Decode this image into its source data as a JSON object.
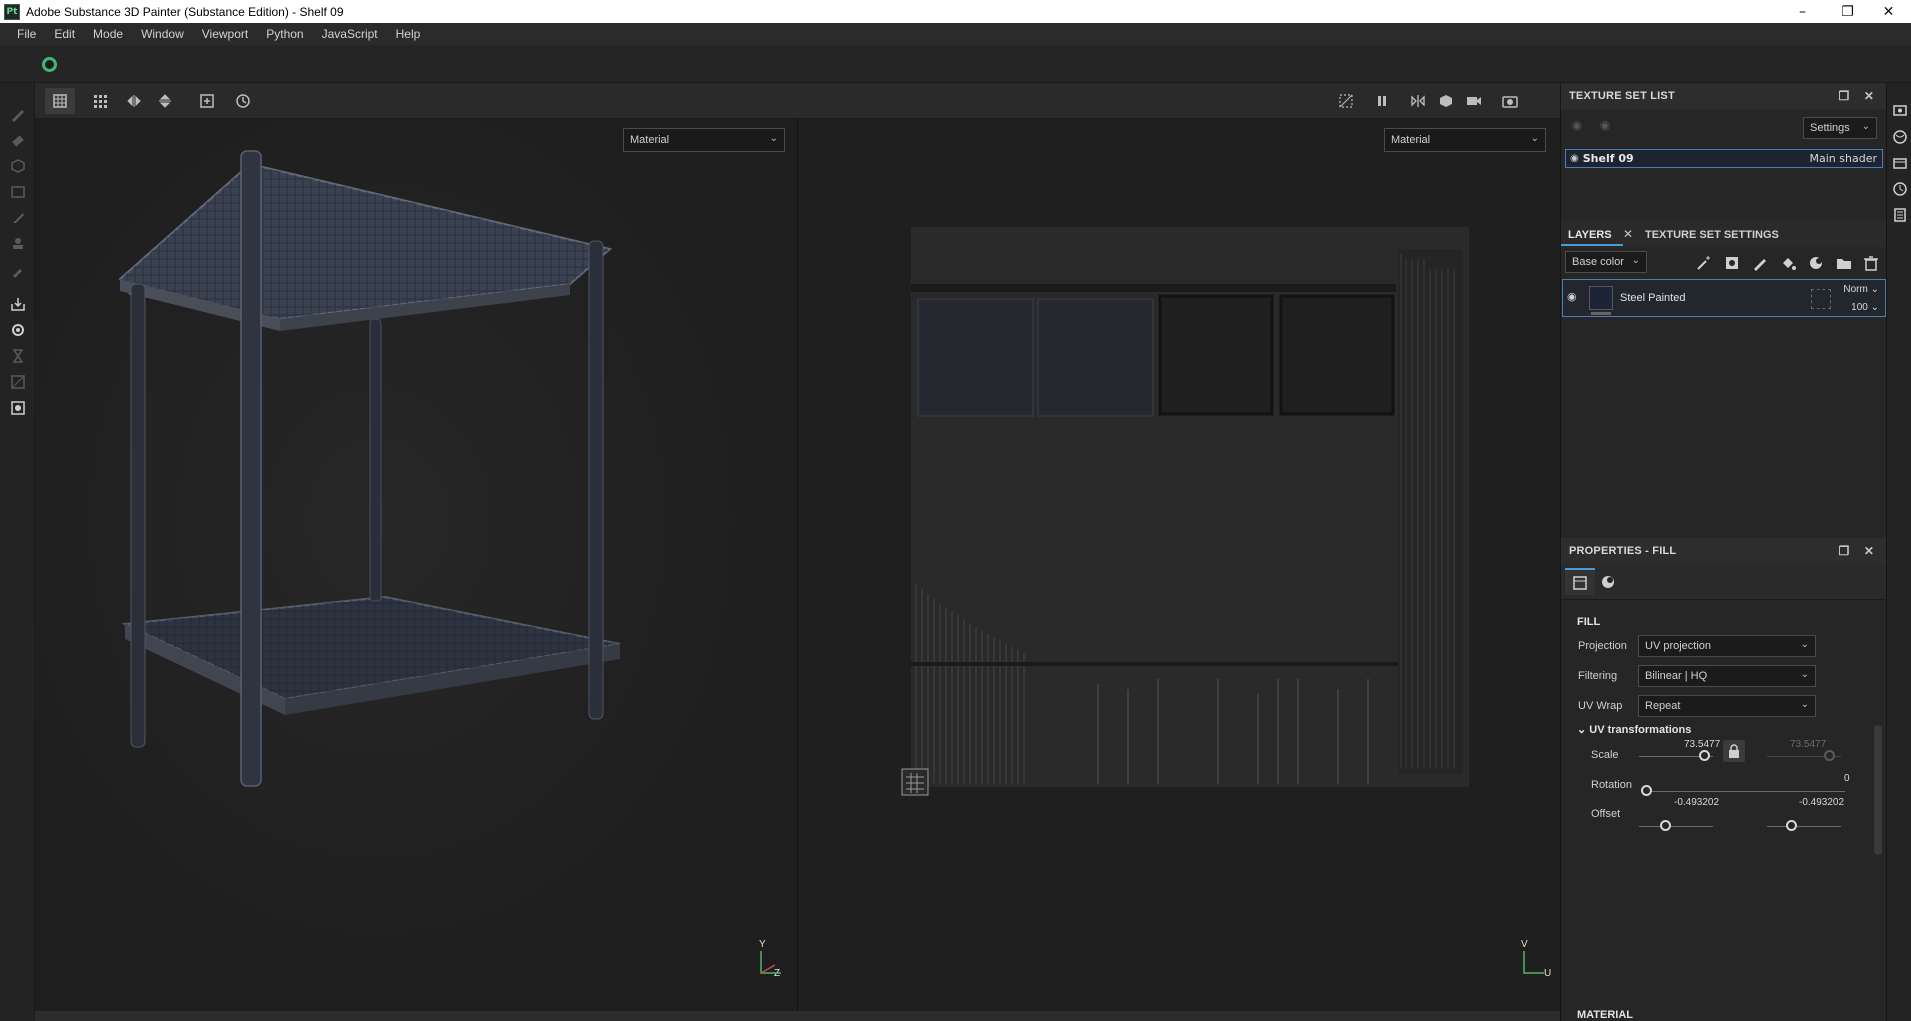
{
  "window": {
    "title": "Adobe Substance 3D Painter (Substance Edition) - Shelf 09",
    "app_icon_text": "Pt",
    "controls": [
      "minimize",
      "restore",
      "close"
    ]
  },
  "menu": [
    "File",
    "Edit",
    "Mode",
    "Window",
    "Viewport",
    "Python",
    "JavaScript",
    "Help"
  ],
  "viewport_toolbar": {
    "left_buttons": [
      "layout-single-icon",
      "layout-grid-icon",
      "mirror-x-icon",
      "mirror-y-icon",
      "add-view-icon",
      "history-icon"
    ],
    "right_buttons": [
      "hide-uv-icon",
      "pause-icon",
      "flip-icon",
      "cube-icon",
      "camera-icon",
      "screenshot-icon"
    ]
  },
  "viewports": {
    "left": {
      "mode": "Material",
      "axis": [
        "Y",
        "Z"
      ]
    },
    "right": {
      "mode": "Material",
      "axis": [
        "V",
        "U"
      ]
    }
  },
  "texture_set_list": {
    "title": "TEXTURE SET LIST",
    "settings_label": "Settings",
    "items": [
      {
        "name": "Shelf 09",
        "shader": "Main shader"
      }
    ]
  },
  "layers": {
    "tabs": [
      "LAYERS",
      "TEXTURE SET SETTINGS"
    ],
    "channel": "Base color",
    "items": [
      {
        "name": "Steel Painted",
        "blend": "Norm",
        "opacity": "100"
      }
    ]
  },
  "properties": {
    "title": "PROPERTIES - FILL",
    "section": "FILL",
    "projection_label": "Projection",
    "projection_value": "UV projection",
    "filtering_label": "Filtering",
    "filtering_value": "Bilinear | HQ",
    "uvwrap_label": "UV Wrap",
    "uvwrap_value": "Repeat",
    "uv_transform_title": "UV transformations",
    "scale_label": "Scale",
    "scale_value": "73.5477",
    "scale_value_locked": "73.5477",
    "rotation_label": "Rotation",
    "rotation_value": "0",
    "offset_label": "Offset",
    "offset_u": "-0.493202",
    "offset_v": "-0.493202",
    "material_section": "MATERIAL"
  }
}
